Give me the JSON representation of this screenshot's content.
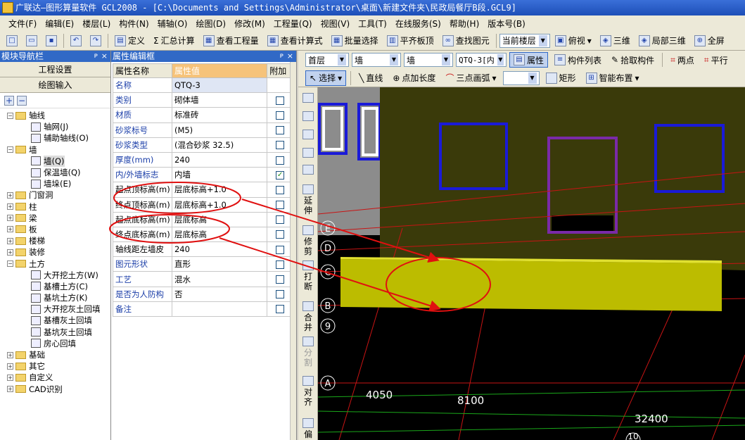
{
  "window": {
    "title": "广联达—图形算量软件 GCL2008 - [C:\\Documents and Settings\\Administrator\\桌面\\新建文件夹\\民政局餐厅B段.GCL9]"
  },
  "menu": [
    "文件(F)",
    "编辑(E)",
    "楼层(L)",
    "构件(N)",
    "辅轴(O)",
    "绘图(D)",
    "修改(M)",
    "工程量(Q)",
    "视图(V)",
    "工具(T)",
    "在线服务(S)",
    "帮助(H)",
    "版本号(B)"
  ],
  "toolbar": {
    "define": "定义",
    "sum_calc": "汇总计算",
    "view_quantity": "查看工程量",
    "view_formula": "查看计算式",
    "batch_select": "批量选择",
    "align_slab": "平齐板顶",
    "find_element": "查找图元",
    "floor_combo": "当前楼层",
    "view_mode": "俯视",
    "three_d": "三维",
    "local_3d": "局部三维",
    "fullscreen": "全屏"
  },
  "nav": {
    "header": "模块导航栏",
    "project_settings": "工程设置",
    "drawing_input": "绘图输入",
    "tree": [
      {
        "label": "轴线",
        "level": 0,
        "kind": "folder",
        "expanded": true
      },
      {
        "label": "轴网(J)",
        "level": 1,
        "kind": "leaf"
      },
      {
        "label": "辅助轴线(O)",
        "level": 1,
        "kind": "leaf"
      },
      {
        "label": "墙",
        "level": 0,
        "kind": "folder",
        "expanded": true
      },
      {
        "label": "墙(Q)",
        "level": 1,
        "kind": "leaf",
        "selected": true
      },
      {
        "label": "保温墙(Q)",
        "level": 1,
        "kind": "leaf"
      },
      {
        "label": "墙垛(E)",
        "level": 1,
        "kind": "leaf"
      },
      {
        "label": "门窗洞",
        "level": 0,
        "kind": "folder",
        "expanded": false
      },
      {
        "label": "柱",
        "level": 0,
        "kind": "folder",
        "expanded": false
      },
      {
        "label": "梁",
        "level": 0,
        "kind": "folder",
        "expanded": false
      },
      {
        "label": "板",
        "level": 0,
        "kind": "folder",
        "expanded": false
      },
      {
        "label": "楼梯",
        "level": 0,
        "kind": "folder",
        "expanded": false
      },
      {
        "label": "装修",
        "level": 0,
        "kind": "folder",
        "expanded": false
      },
      {
        "label": "土方",
        "level": 0,
        "kind": "folder",
        "expanded": true
      },
      {
        "label": "大开挖土方(W)",
        "level": 1,
        "kind": "leaf"
      },
      {
        "label": "基槽土方(C)",
        "level": 1,
        "kind": "leaf"
      },
      {
        "label": "基坑土方(K)",
        "level": 1,
        "kind": "leaf"
      },
      {
        "label": "大开挖灰土回填",
        "level": 1,
        "kind": "leaf"
      },
      {
        "label": "基槽灰土回填",
        "level": 1,
        "kind": "leaf"
      },
      {
        "label": "基坑灰土回填",
        "level": 1,
        "kind": "leaf"
      },
      {
        "label": "房心回填",
        "level": 1,
        "kind": "leaf"
      },
      {
        "label": "基础",
        "level": 0,
        "kind": "folder",
        "expanded": false
      },
      {
        "label": "其它",
        "level": 0,
        "kind": "folder",
        "expanded": false
      },
      {
        "label": "自定义",
        "level": 0,
        "kind": "folder",
        "expanded": false
      },
      {
        "label": "CAD识别",
        "level": 0,
        "kind": "folder",
        "expanded": false
      }
    ]
  },
  "props": {
    "header": "属性编辑框",
    "columns": [
      "属性名称",
      "属性值",
      "附加"
    ],
    "rows": [
      {
        "name": "名称",
        "value": "QTQ-3",
        "check": null,
        "blue": true
      },
      {
        "name": "类别",
        "value": "砌体墙",
        "check": false,
        "blue": true
      },
      {
        "name": "材质",
        "value": "标准砖",
        "check": false,
        "blue": true
      },
      {
        "name": "砂浆标号",
        "value": "(M5)",
        "check": false,
        "blue": true
      },
      {
        "name": "砂浆类型",
        "value": "(混合砂浆  32.5)",
        "check": false,
        "blue": true
      },
      {
        "name": "厚度(mm)",
        "value": "240",
        "check": false,
        "blue": true
      },
      {
        "name": "内/外墙标志",
        "value": "内墙",
        "check": true,
        "blue": true
      },
      {
        "name": "起点顶标高(m)",
        "value": "层底标高+1.0",
        "check": false,
        "blue": false
      },
      {
        "name": "终点顶标高(m)",
        "value": "层底标高+1.0",
        "check": false,
        "blue": false
      },
      {
        "name": "起点底标高(m)",
        "value": "层底标高",
        "check": false,
        "blue": false
      },
      {
        "name": "终点底标高(m)",
        "value": "层底标高",
        "check": false,
        "blue": false
      },
      {
        "name": "轴线距左墙皮",
        "value": "240",
        "check": false,
        "blue": false
      },
      {
        "name": "图元形状",
        "value": "直形",
        "check": false,
        "blue": true
      },
      {
        "name": "工艺",
        "value": "混水",
        "check": false,
        "blue": true
      },
      {
        "name": "是否为人防构",
        "value": "否",
        "check": false,
        "blue": true
      },
      {
        "name": "备注",
        "value": "",
        "check": false,
        "blue": true
      }
    ]
  },
  "drawbar1": {
    "floor": "首层",
    "type1": "墙",
    "type2": "墙",
    "element": "QTQ-3[内",
    "attr": "属性",
    "list": "构件列表",
    "pick": "拾取构件",
    "two_pt": "两点",
    "parallel": "平行"
  },
  "drawbar2": {
    "select": "选择",
    "line": "直线",
    "add_len": "点加长度",
    "arc": "三点画弧",
    "rect": "矩形",
    "smart": "智能布置"
  },
  "vtools": {
    "extend": "延伸",
    "trim": "修剪",
    "break": "打断",
    "merge": "合并",
    "split": "分割",
    "align": "对齐",
    "offset": "偏"
  },
  "canvas": {
    "axes": [
      "E",
      "D",
      "C",
      "B",
      "9",
      "A",
      "10"
    ],
    "dims": [
      "4050",
      "8100",
      "32400"
    ],
    "colors": {
      "wall_face": "#3a3a0a",
      "wall_yellow": "#bcbc00",
      "grid_red": "#c81414",
      "win_blue": "#1a1ad8",
      "win_purple": "#7a2aa8"
    }
  }
}
